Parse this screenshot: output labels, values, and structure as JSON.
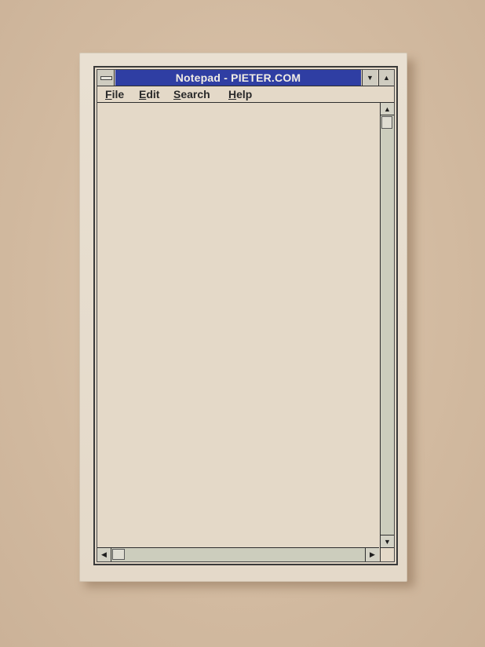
{
  "window": {
    "title": "Notepad - PIETER.COM",
    "system_menu_icon": "system-menu-icon",
    "minimize_icon": "minimize-icon",
    "maximize_icon": "maximize-icon",
    "minimize_glyph": "▼",
    "maximize_glyph": "▲",
    "title_bar_color": "#2f3ea3"
  },
  "menu": {
    "file": {
      "mnemonic": "F",
      "rest": "ile"
    },
    "edit": {
      "mnemonic": "E",
      "rest": "dit"
    },
    "search": {
      "mnemonic": "S",
      "rest": "earch"
    },
    "help": {
      "mnemonic": "H",
      "rest": "elp"
    }
  },
  "editor": {
    "content": ""
  },
  "scrollbars": {
    "up_glyph": "▲",
    "down_glyph": "▼",
    "left_glyph": "◀",
    "right_glyph": "▶"
  }
}
